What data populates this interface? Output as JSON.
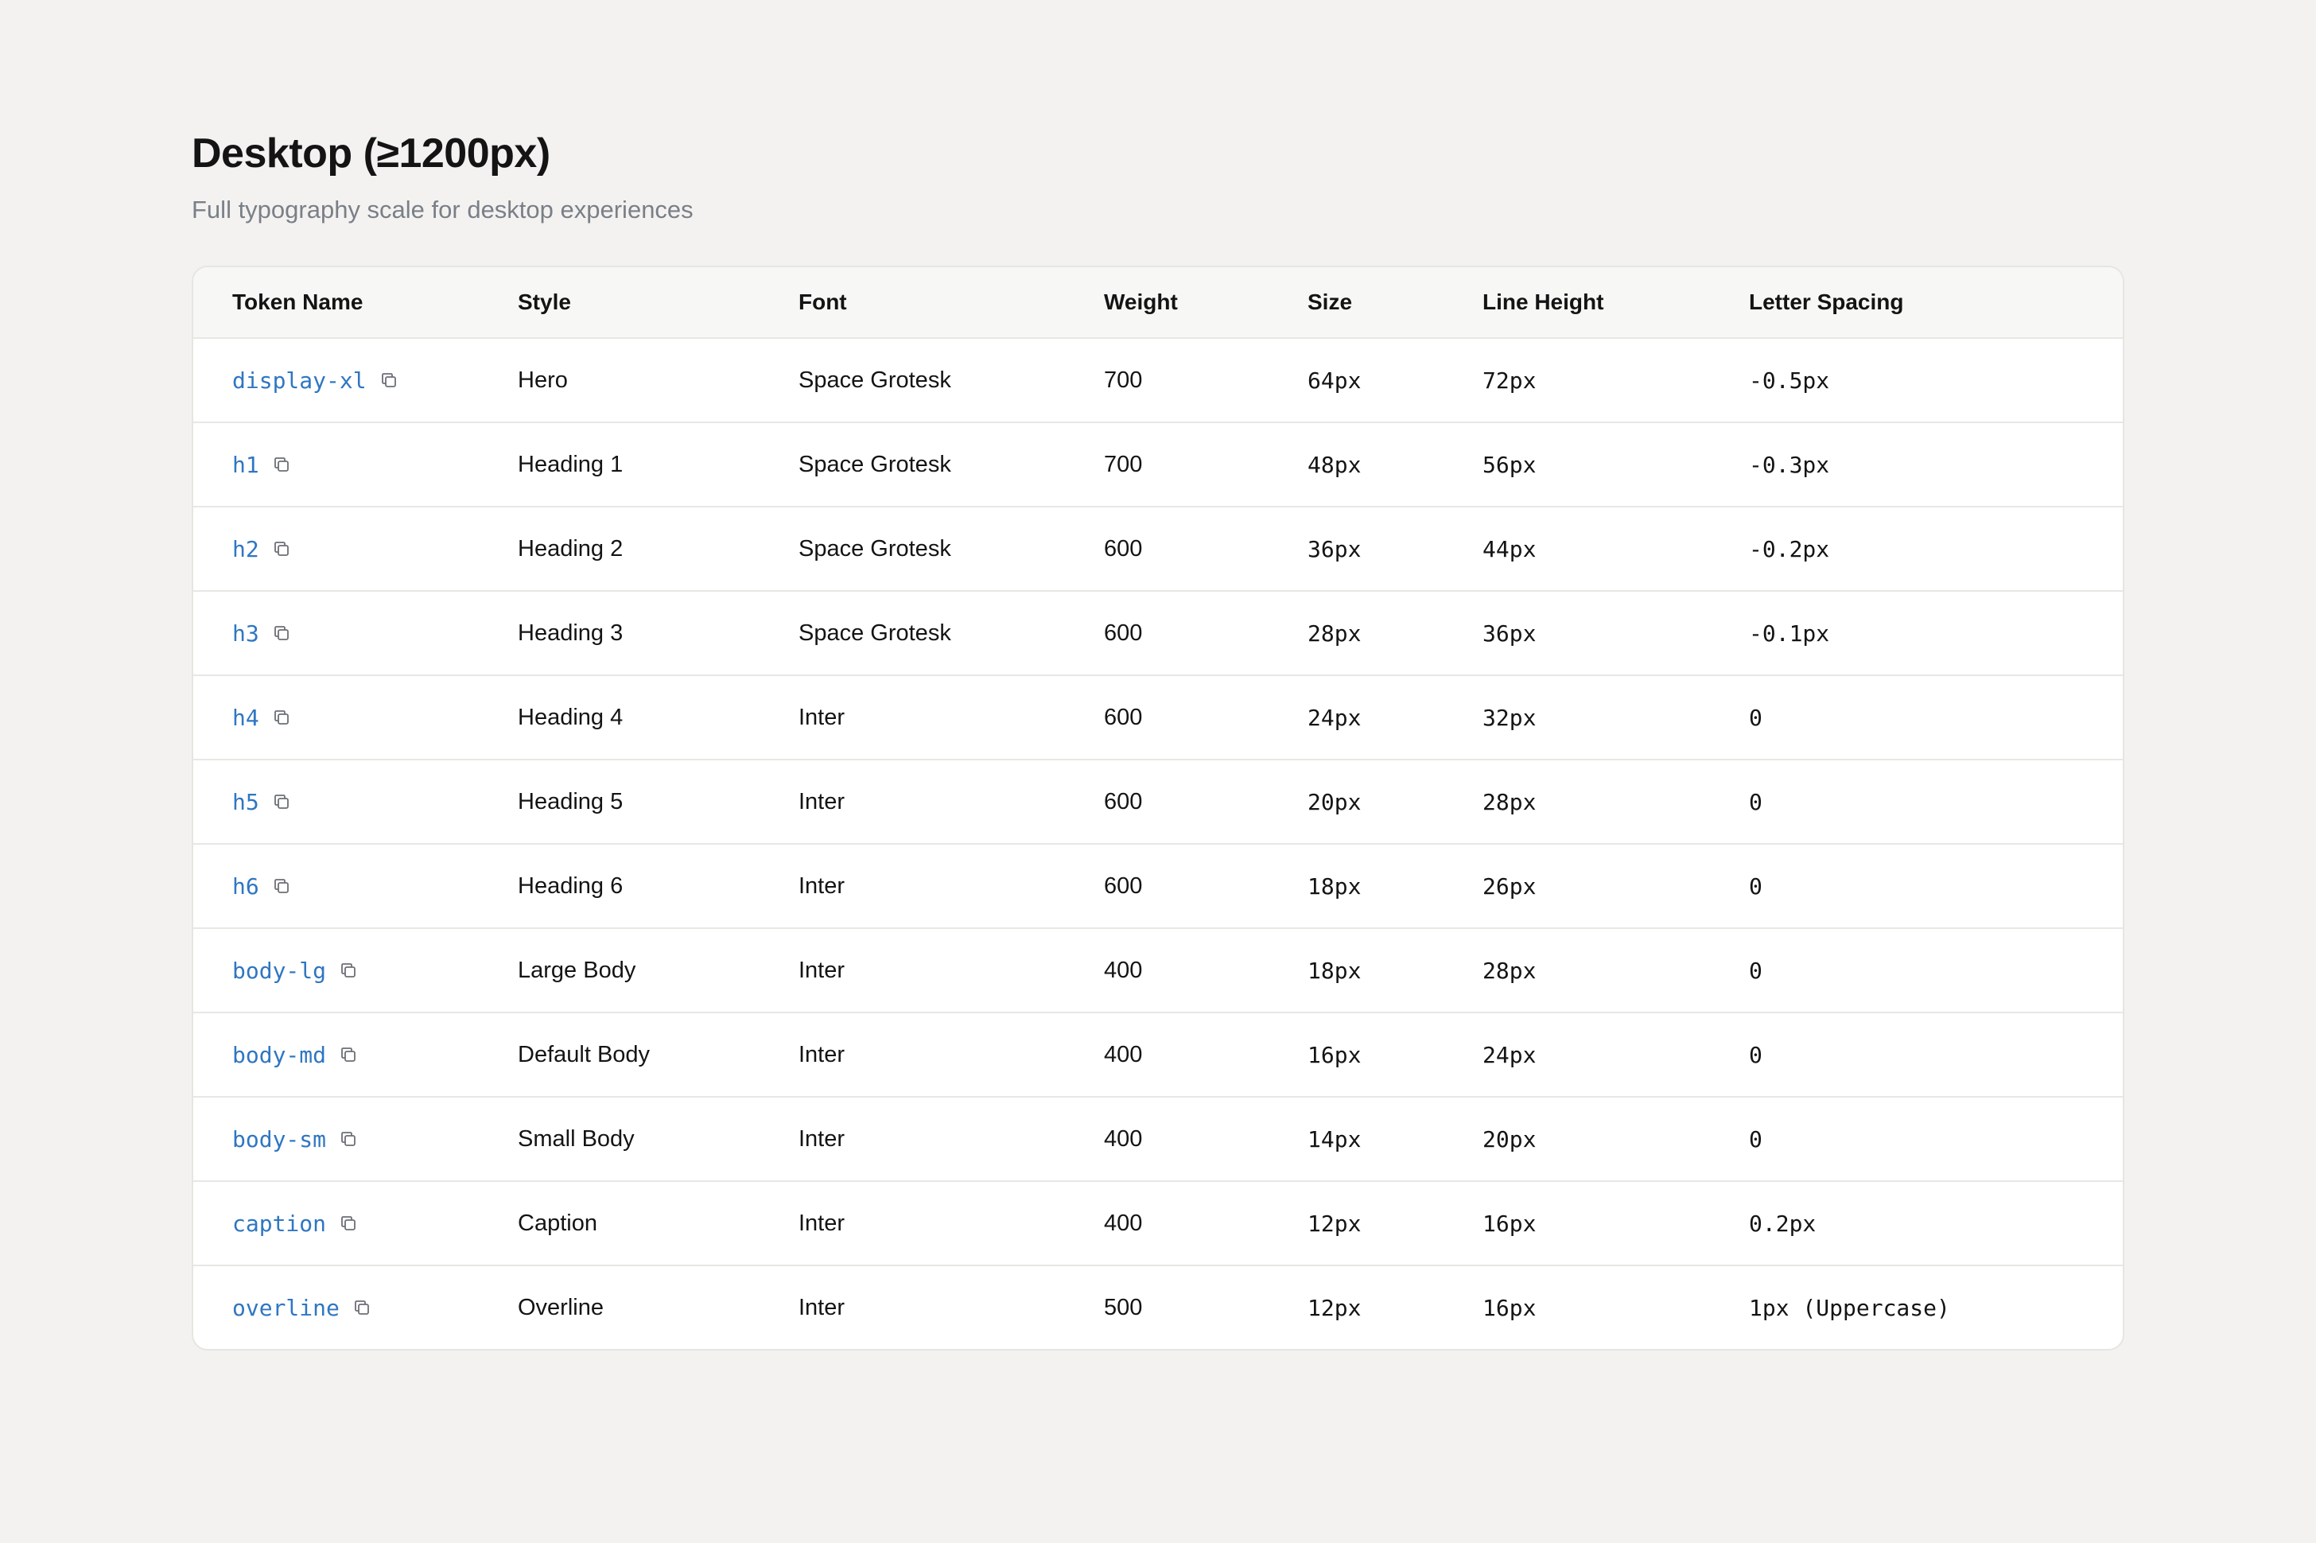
{
  "page": {
    "title": "Desktop (≥1200px)",
    "subtitle": "Full typography scale for desktop experiences"
  },
  "table": {
    "headers": [
      "Token Name",
      "Style",
      "Font",
      "Weight",
      "Size",
      "Line Height",
      "Letter Spacing"
    ],
    "rows": [
      {
        "token": "display-xl",
        "style": "Hero",
        "font": "Space Grotesk",
        "weight": "700",
        "size": "64px",
        "line_height": "72px",
        "letter_spacing": "-0.5px"
      },
      {
        "token": "h1",
        "style": "Heading 1",
        "font": "Space Grotesk",
        "weight": "700",
        "size": "48px",
        "line_height": "56px",
        "letter_spacing": "-0.3px"
      },
      {
        "token": "h2",
        "style": "Heading 2",
        "font": "Space Grotesk",
        "weight": "600",
        "size": "36px",
        "line_height": "44px",
        "letter_spacing": "-0.2px"
      },
      {
        "token": "h3",
        "style": "Heading 3",
        "font": "Space Grotesk",
        "weight": "600",
        "size": "28px",
        "line_height": "36px",
        "letter_spacing": "-0.1px"
      },
      {
        "token": "h4",
        "style": "Heading 4",
        "font": "Inter",
        "weight": "600",
        "size": "24px",
        "line_height": "32px",
        "letter_spacing": "0"
      },
      {
        "token": "h5",
        "style": "Heading 5",
        "font": "Inter",
        "weight": "600",
        "size": "20px",
        "line_height": "28px",
        "letter_spacing": "0"
      },
      {
        "token": "h6",
        "style": "Heading 6",
        "font": "Inter",
        "weight": "600",
        "size": "18px",
        "line_height": "26px",
        "letter_spacing": "0"
      },
      {
        "token": "body-lg",
        "style": "Large Body",
        "font": "Inter",
        "weight": "400",
        "size": "18px",
        "line_height": "28px",
        "letter_spacing": "0"
      },
      {
        "token": "body-md",
        "style": "Default Body",
        "font": "Inter",
        "weight": "400",
        "size": "16px",
        "line_height": "24px",
        "letter_spacing": "0"
      },
      {
        "token": "body-sm",
        "style": "Small Body",
        "font": "Inter",
        "weight": "400",
        "size": "14px",
        "line_height": "20px",
        "letter_spacing": "0"
      },
      {
        "token": "caption",
        "style": "Caption",
        "font": "Inter",
        "weight": "400",
        "size": "12px",
        "line_height": "16px",
        "letter_spacing": "0.2px"
      },
      {
        "token": "overline",
        "style": "Overline",
        "font": "Inter",
        "weight": "500",
        "size": "12px",
        "line_height": "16px",
        "letter_spacing": "1px (Uppercase)"
      }
    ]
  },
  "icons": {
    "copy": "copy-icon"
  },
  "colors": {
    "background": "#f3f2f0",
    "token_link": "#2f76c2",
    "subtitle": "#7a7f87",
    "header_bg": "#f7f7f5",
    "border": "#e8e7e4"
  }
}
